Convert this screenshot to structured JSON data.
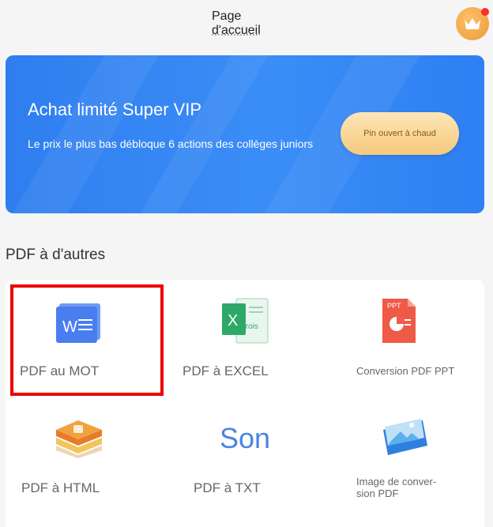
{
  "header": {
    "title_line1": "Page",
    "title_line2": "d'accueil"
  },
  "banner": {
    "title": "Achat limité Super VIP",
    "subtitle": "Le prix le plus bas débloque 6 actions des collèges juniors",
    "button": "Pin ouvert à chaud"
  },
  "section": {
    "title": "PDF à d'autres"
  },
  "tools": [
    {
      "label": "PDF au MOT",
      "icon": "word-doc-icon",
      "icon_text": "W"
    },
    {
      "label": "PDF à EXCEL",
      "icon": "excel-doc-icon",
      "icon_text": "X",
      "icon_subtext": "Trois"
    },
    {
      "label": "Conversion PDF PPT",
      "icon": "ppt-doc-icon",
      "icon_text": "PPT"
    },
    {
      "label": "PDF à HTML",
      "icon": "html-stack-icon"
    },
    {
      "label": "PDF à TXT",
      "icon": "txt-icon",
      "icon_text": "Son"
    },
    {
      "label": "Image de conver-\nsion PDF",
      "icon": "image-folder-icon"
    }
  ],
  "colors": {
    "banner": "#3b8df6",
    "selection": "#ee0000",
    "accent": "#4a84e4"
  }
}
